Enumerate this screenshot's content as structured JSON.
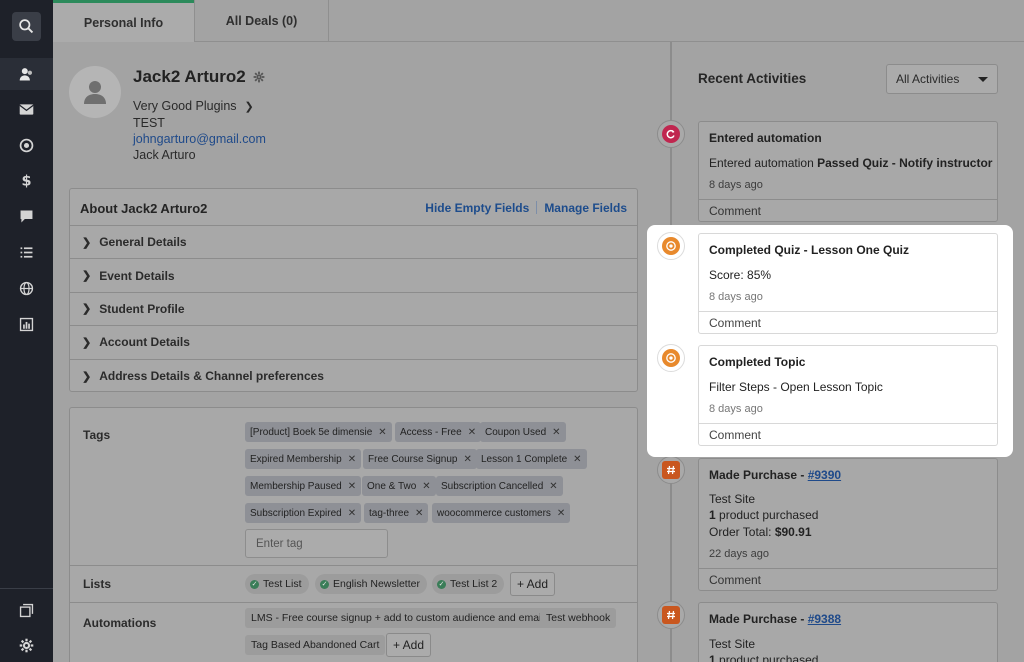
{
  "tabs": [
    {
      "label": "Personal Info"
    },
    {
      "label": "All Deals (0)"
    }
  ],
  "profile": {
    "name": "Jack2 Arturo2",
    "company": "Very Good Plugins",
    "note": "TEST",
    "email": "johngarturo@gmail.com",
    "full_name": "Jack Arturo"
  },
  "about": {
    "title": "About Jack2 Arturo2",
    "hide_empty": "Hide Empty Fields",
    "manage_fields": "Manage Fields",
    "sections": [
      "General Details",
      "Event Details",
      "Student Profile",
      "Account Details",
      "Address Details & Channel preferences"
    ]
  },
  "tags": {
    "label": "Tags",
    "items": [
      "[Product] Boek 5e dimensie",
      "Access - Free",
      "Coupon Used",
      "Expired Membership",
      "Free Course Signup",
      "Lesson 1 Complete",
      "Membership Paused",
      "One & Two",
      "Subscription Cancelled",
      "Subscription Expired",
      "tag-three",
      "woocommerce customers"
    ],
    "placeholder": "Enter tag"
  },
  "lists": {
    "label": "Lists",
    "items": [
      "Test List",
      "English Newsletter",
      "Test List 2"
    ],
    "add": "+ Add"
  },
  "automations": {
    "label": "Automations",
    "items": [
      "LMS - Free course signup + add to custom audience and email",
      "Test webhook",
      "Tag Based Abandoned Cart"
    ],
    "add": "+ Add"
  },
  "activities": {
    "title": "Recent Activities",
    "filter": "All Activities",
    "comment_label": "Comment",
    "items": [
      {
        "title": "Entered automation",
        "line1_pre": "Entered automation ",
        "line1_bold": "Passed Quiz - Notify instructor",
        "date": "8 days ago",
        "color": "#c0264f"
      },
      {
        "title": "Completed Quiz - Lesson One Quiz",
        "line1": "Score: 85%",
        "date": "8 days ago",
        "color": "#e8892c"
      },
      {
        "title": "Completed Topic",
        "line1": "Filter Steps - Open Lesson Topic",
        "date": "8 days ago",
        "color": "#e8892c"
      },
      {
        "title_pre": "Made Purchase - ",
        "title_link": "#9390",
        "line1": "Test Site",
        "line2_bold": "1",
        "line2": " product purchased",
        "line3_pre": "Order Total: ",
        "line3_bold": "$90.91",
        "date": "22 days ago",
        "color": "#c9571f"
      },
      {
        "title_pre": "Made Purchase - ",
        "title_link": "#9388",
        "line1": "Test Site",
        "line2_bold": "1",
        "line2": " product purchased",
        "color": "#c9571f"
      }
    ]
  },
  "icons": {
    "rail": [
      "search-icon",
      "contacts-icon",
      "mail-icon",
      "target-icon",
      "dollar-icon",
      "chat-icon",
      "list-icon",
      "globe-icon",
      "chart-icon",
      "windows-icon",
      "gear-icon"
    ]
  }
}
